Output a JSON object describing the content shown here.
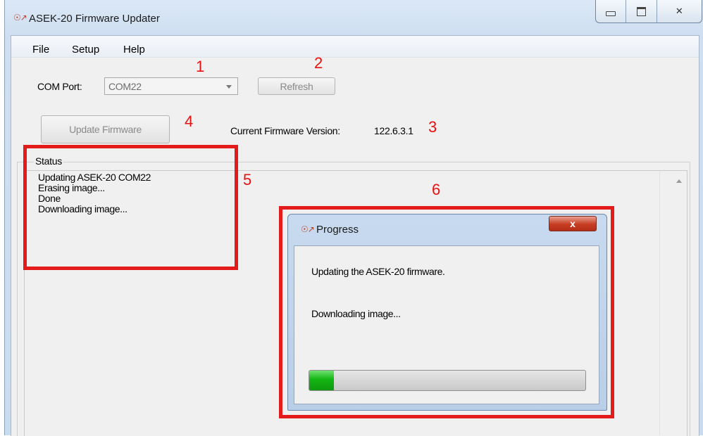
{
  "window": {
    "title": "ASEK-20 Firmware Updater",
    "caption_buttons": [
      "minimize",
      "maximize",
      "close"
    ]
  },
  "menu": {
    "items": [
      "File",
      "Setup",
      "Help"
    ]
  },
  "com_port": {
    "label": "COM Port:",
    "value": "COM22"
  },
  "refresh_button": {
    "label": "Refresh"
  },
  "update_button": {
    "label": "Update Firmware"
  },
  "firmware": {
    "label": "Current Firmware Version:",
    "value": "122.6.3.1"
  },
  "status": {
    "label": "Status",
    "lines": [
      "Updating ASEK-20 COM22",
      "Erasing image...",
      "Done",
      "Downloading image..."
    ]
  },
  "annotations": [
    "1",
    "2",
    "3",
    "4",
    "5",
    "6"
  ],
  "progress_dialog": {
    "title": "Progress",
    "close_glyph": "x",
    "message": "Updating the ASEK-20 firmware.",
    "status": "Downloading image...",
    "progress_fraction": 0.09
  },
  "colors": {
    "annotation_red": "#e81010",
    "progress_green": "#13b513"
  }
}
